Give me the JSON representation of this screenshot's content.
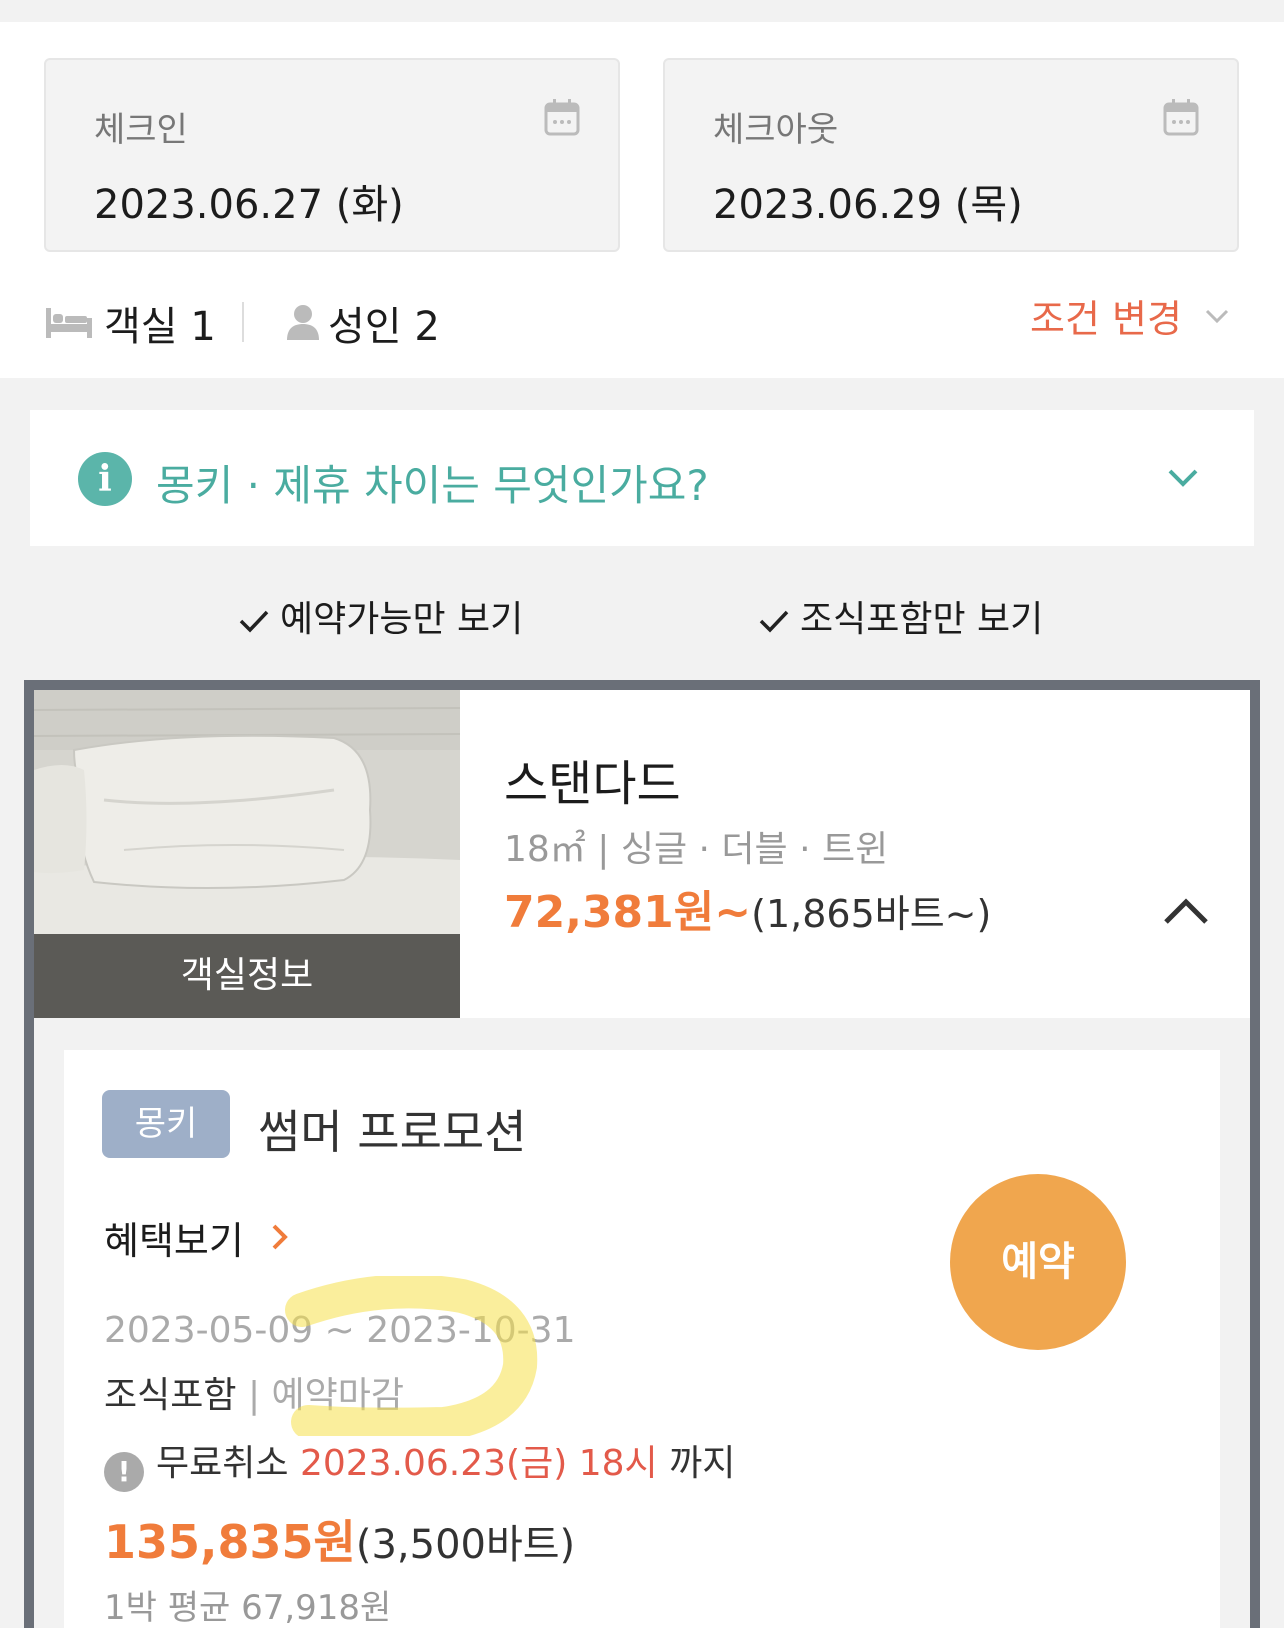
{
  "search": {
    "checkin": {
      "label": "체크인",
      "value": "2023.06.27 (화)"
    },
    "checkout": {
      "label": "체크아웃",
      "value": "2023.06.29 (목)"
    },
    "rooms": "객실 1",
    "adults": "성인 2",
    "change_label": "조건 변경"
  },
  "info_banner": {
    "text": "몽키 · 제휴 차이는 무엇인가요?"
  },
  "filters": [
    {
      "label": "예약가능만 보기",
      "checked": true
    },
    {
      "label": "조식포함만 보기",
      "checked": true
    }
  ],
  "room": {
    "image_caption": "객실정보",
    "name": "스탠다드",
    "specs": "18㎡ | 싱글 · 더블 · 트윈",
    "price_krw": "72,381원~",
    "price_thb": "(1,865바트~)",
    "plan": {
      "badge": "몽키",
      "name": "썸머 프로모션",
      "benefit_link": "혜택보기",
      "period": "2023-05-09 ~ 2023-10-31",
      "tag_breakfast": "조식포함",
      "tag_status": "| 예약마감",
      "cancel_prefix": "무료취소",
      "cancel_date": "2023.06.23(금) 18시",
      "cancel_suffix": "까지",
      "price_krw": "135,835원",
      "price_thb": "(3,500바트)",
      "avg_price": "1박 평균 67,918원",
      "book_label": "예약"
    }
  },
  "colors": {
    "accent_orange": "#f07c3b",
    "teal": "#4aaca0",
    "book_button": "#f0a64e",
    "badge": "#9eafc8",
    "cancel_red": "#e35a4a",
    "annotation_highlight": "#f5e04a"
  },
  "icons": {
    "calendar": "calendar-icon",
    "bed": "bed-icon",
    "person": "person-icon",
    "info": "info-icon",
    "check": "check-icon",
    "warning": "warning-icon"
  }
}
